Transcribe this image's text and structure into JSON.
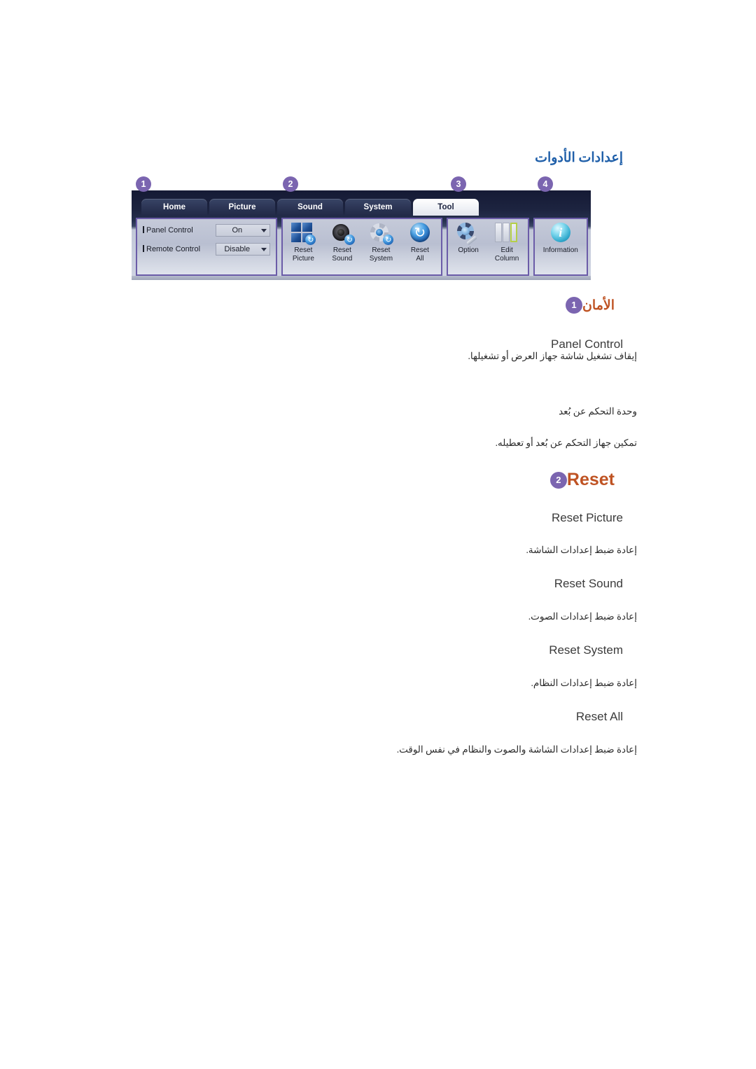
{
  "page": {
    "title": "إعدادات الأدوات",
    "title_color": "#1f5fa9",
    "heading_color": "#bf5323",
    "badge_color": "#7b65b0"
  },
  "toolbar": {
    "tabs": [
      {
        "label": "Home",
        "active": false
      },
      {
        "label": "Picture",
        "active": false
      },
      {
        "label": "Sound",
        "active": false
      },
      {
        "label": "System",
        "active": false
      },
      {
        "label": "Tool",
        "active": true
      }
    ],
    "badges": [
      "1",
      "2",
      "3",
      "4"
    ],
    "panel_group": {
      "rows": [
        {
          "label": "Panel Control",
          "value": "On"
        },
        {
          "label": "Remote Control",
          "value": "Disable"
        }
      ]
    },
    "reset_group": {
      "buttons": [
        {
          "line1": "Reset",
          "line2": "Picture",
          "icon": "reset-picture-icon"
        },
        {
          "line1": "Reset",
          "line2": "Sound",
          "icon": "reset-sound-icon"
        },
        {
          "line1": "Reset",
          "line2": "System",
          "icon": "reset-system-icon"
        },
        {
          "line1": "Reset",
          "line2": "All",
          "icon": "reset-all-icon"
        }
      ]
    },
    "option_group": {
      "buttons": [
        {
          "line1": "Option",
          "line2": "",
          "icon": "option-icon"
        },
        {
          "line1": "Edit",
          "line2": "Column",
          "icon": "edit-column-icon"
        }
      ]
    },
    "info_group": {
      "buttons": [
        {
          "line1": "Information",
          "line2": "",
          "icon": "information-icon"
        }
      ]
    }
  },
  "sections": [
    {
      "badge": "1",
      "heading": "الأمان",
      "heading_lang": "ar",
      "items": [
        {
          "title": "Panel Control",
          "desc": "إيقاف تشغيل شاشة جهاز العرض أو تشغيلها."
        },
        {
          "title": "",
          "desc": "وحدة التحكم عن بُعد"
        },
        {
          "title": "",
          "desc": "تمكين جهاز التحكم عن بُعد أو تعطيله."
        }
      ]
    },
    {
      "badge": "2",
      "heading": "Reset",
      "heading_lang": "en",
      "items": [
        {
          "title": "Reset Picture",
          "desc": "إعادة ضبط إعدادات الشاشة."
        },
        {
          "title": "Reset Sound",
          "desc": "إعادة ضبط إعدادات الصوت."
        },
        {
          "title": "Reset System",
          "desc": "إعادة ضبط إعدادات النظام."
        },
        {
          "title": "Reset All",
          "desc": "إعادة ضبط إعدادات الشاشة والصوت والنظام في نفس الوقت."
        }
      ]
    }
  ]
}
